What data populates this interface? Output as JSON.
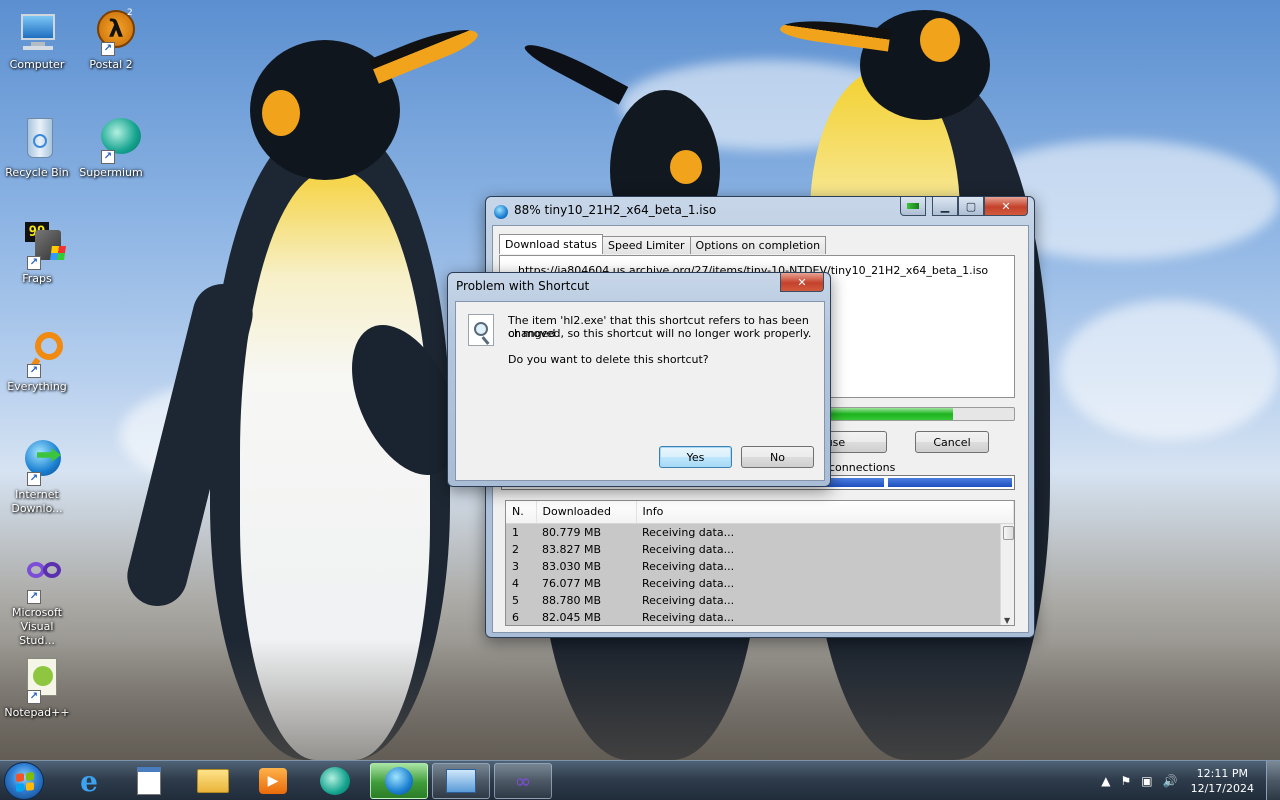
{
  "desktop": {
    "icons": [
      {
        "label": "Computer",
        "icon": "computer-icon"
      },
      {
        "label": "Postal 2",
        "icon": "half-life-icon"
      },
      {
        "label": "Recycle Bin",
        "icon": "recycle-bin-icon"
      },
      {
        "label": "Supermium",
        "icon": "supermium-icon"
      },
      {
        "label": "Fraps",
        "icon": "fraps-icon",
        "badge": "99"
      },
      {
        "label": "Everything",
        "icon": "everything-search-icon"
      },
      {
        "label": "Internet Downlo...",
        "icon": "idm-icon"
      },
      {
        "label": "Microsoft Visual Stud...",
        "icon": "visual-studio-icon"
      },
      {
        "label": "Notepad++",
        "icon": "notepad-plus-plus-icon"
      }
    ],
    "half_life_badge": "2",
    "half_life_glyph": "λ"
  },
  "idm_window": {
    "title": "88% tiny10_21H2_x64_beta_1.iso",
    "tabs": [
      "Download status",
      "Speed Limiter",
      "Options on completion"
    ],
    "url": "https://ia804604.us.archive.org/27/items/tiny-10-NTDEV/tiny10_21H2_x64_beta_1.iso",
    "progress_fraction": 0.88,
    "pause_label": "Pause",
    "cancel_label": "Cancel",
    "connections_label": "connections",
    "connection_segments": 4,
    "columns": [
      "N.",
      "Downloaded",
      "Info"
    ],
    "rows": [
      {
        "n": "1",
        "downloaded": "80.779  MB",
        "info": "Receiving data..."
      },
      {
        "n": "2",
        "downloaded": "83.827  MB",
        "info": "Receiving data..."
      },
      {
        "n": "3",
        "downloaded": "83.030  MB",
        "info": "Receiving data..."
      },
      {
        "n": "4",
        "downloaded": "76.077  MB",
        "info": "Receiving data..."
      },
      {
        "n": "5",
        "downloaded": "88.780  MB",
        "info": "Receiving data..."
      },
      {
        "n": "6",
        "downloaded": "82.045  MB",
        "info": "Receiving data..."
      }
    ],
    "colors": {
      "progress": "#1db31d",
      "connections": "#1f4fbf"
    }
  },
  "dialog": {
    "title": "Problem with Shortcut",
    "message_line1": "The item 'hl2.exe' that this shortcut refers to has been changed",
    "message_line2": "or moved, so this shortcut will no longer work properly.",
    "question": "Do you want to delete this shortcut?",
    "yes_label": "Yes",
    "no_label": "No",
    "icon": "shortcut-search-icon"
  },
  "taskbar": {
    "pinned": [
      "internet-explorer-icon",
      "notepad-icon",
      "file-explorer-icon",
      "media-player-icon",
      "supermium-icon",
      "idm-icon",
      "control-panel-icon",
      "visual-studio-icon"
    ],
    "active_item": "idm-icon",
    "time": "12:11 PM",
    "date": "12/17/2024"
  }
}
